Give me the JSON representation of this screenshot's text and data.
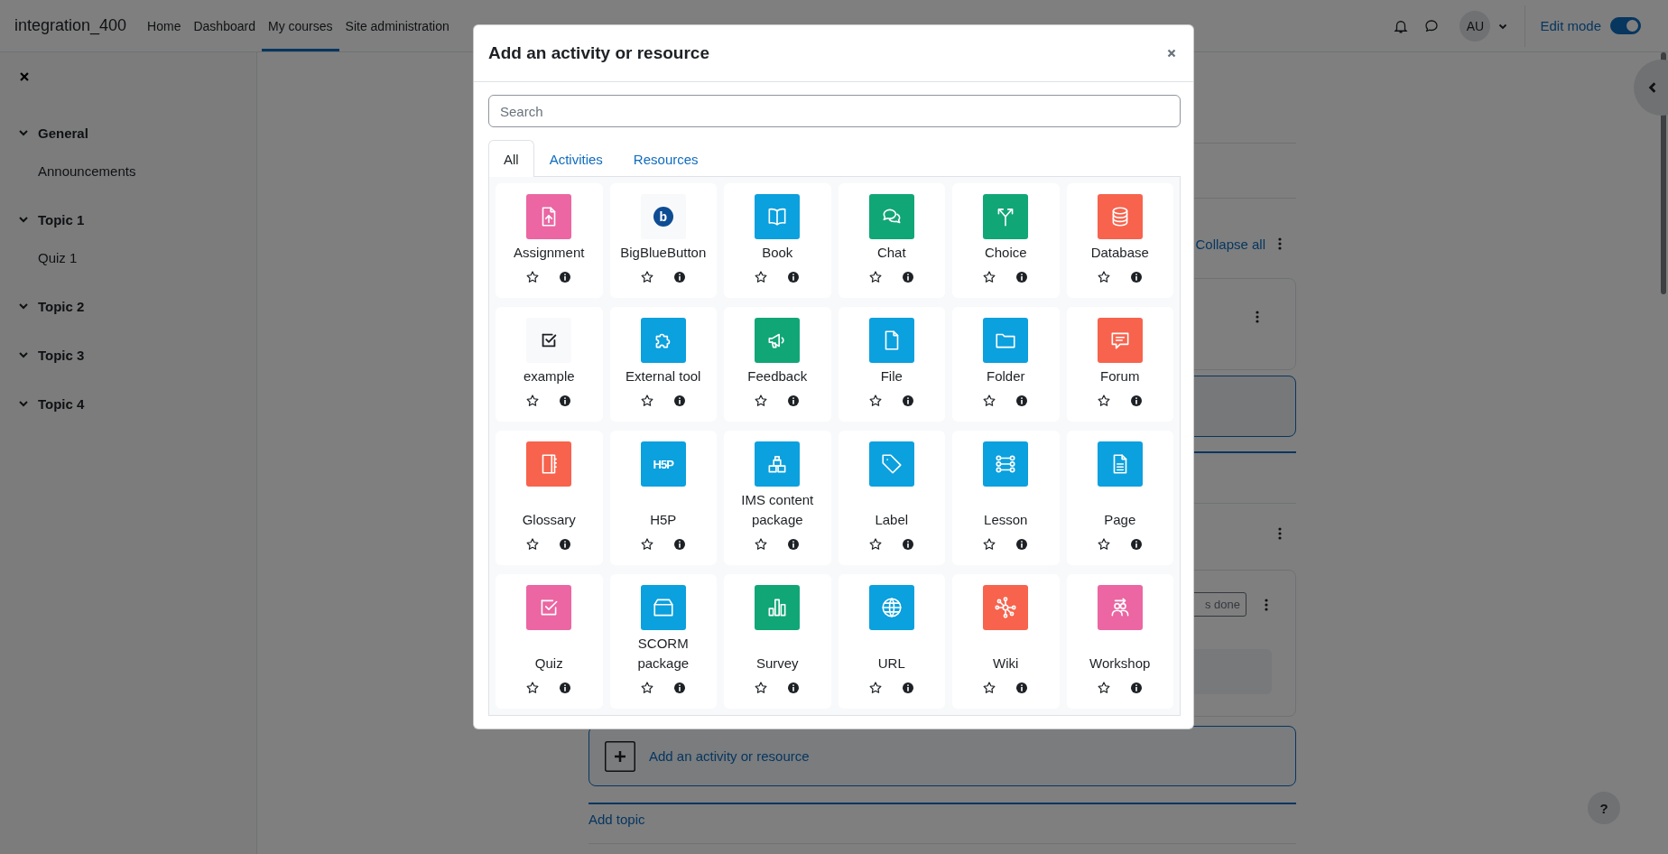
{
  "navbar": {
    "brand": "integration_400",
    "links": [
      {
        "label": "Home",
        "selected": false
      },
      {
        "label": "Dashboard",
        "selected": false
      },
      {
        "label": "My courses",
        "selected": true
      },
      {
        "label": "Site administration",
        "selected": false
      }
    ],
    "avatar": "AU",
    "edit_mode": {
      "label": "Edit mode",
      "on": true
    }
  },
  "drawer": {
    "sections": [
      {
        "label": "General",
        "expanded": true,
        "children": [
          {
            "label": "Announcements"
          }
        ]
      },
      {
        "label": "Topic 1",
        "expanded": true,
        "children": [
          {
            "label": "Quiz 1"
          }
        ]
      },
      {
        "label": "Topic 2",
        "expanded": true
      },
      {
        "label": "Topic 3",
        "expanded": true
      },
      {
        "label": "Topic 4",
        "expanded": true
      }
    ]
  },
  "course": {
    "collapse_all": "Collapse all",
    "badge": "s done",
    "add_activity": "Add an activity or resource",
    "add_topic": "Add topic"
  },
  "modal": {
    "title": "Add an activity or resource",
    "search": {
      "placeholder": "Search"
    },
    "tabs": [
      {
        "label": "All",
        "selected": true
      },
      {
        "label": "Activities",
        "selected": false
      },
      {
        "label": "Resources",
        "selected": false
      }
    ],
    "items": [
      {
        "name": "Assignment",
        "color": "#eb66a2",
        "starred": false
      },
      {
        "name": "BigBlueButton",
        "color": "#f8f9fa",
        "starred": false,
        "icon_text": "b"
      },
      {
        "name": "Book",
        "color": "#0ba0de",
        "starred": false
      },
      {
        "name": "Chat",
        "color": "#11a676",
        "starred": false
      },
      {
        "name": "Choice",
        "color": "#11a676",
        "starred": false
      },
      {
        "name": "Database",
        "color": "#f7634d",
        "starred": false
      },
      {
        "name": "example",
        "color": "#f8f9fa",
        "starred": false
      },
      {
        "name": "External tool",
        "color": "#0ba0de",
        "starred": false
      },
      {
        "name": "Feedback",
        "color": "#11a676",
        "starred": false
      },
      {
        "name": "File",
        "color": "#0ba0de",
        "starred": false
      },
      {
        "name": "Folder",
        "color": "#0ba0de",
        "starred": false
      },
      {
        "name": "Forum",
        "color": "#f7634d",
        "starred": false
      },
      {
        "name": "Glossary",
        "color": "#f7634d",
        "starred": false
      },
      {
        "name": "H5P",
        "color": "#0ba0de",
        "starred": false,
        "icon_text": "H5P"
      },
      {
        "name": "IMS content package",
        "color": "#0ba0de",
        "starred": false
      },
      {
        "name": "Label",
        "color": "#0ba0de",
        "starred": false
      },
      {
        "name": "Lesson",
        "color": "#0ba0de",
        "starred": false
      },
      {
        "name": "Page",
        "color": "#0ba0de",
        "starred": false
      },
      {
        "name": "Quiz",
        "color": "#eb66a2",
        "starred": false
      },
      {
        "name": "SCORM package",
        "color": "#0ba0de",
        "starred": false
      },
      {
        "name": "Survey",
        "color": "#11a676",
        "starred": false
      },
      {
        "name": "URL",
        "color": "#0ba0de",
        "starred": false
      },
      {
        "name": "Wiki",
        "color": "#f7634d",
        "starred": false
      },
      {
        "name": "Workshop",
        "color": "#eb66a2",
        "starred": false
      }
    ]
  },
  "help_button": {
    "label": "?"
  }
}
